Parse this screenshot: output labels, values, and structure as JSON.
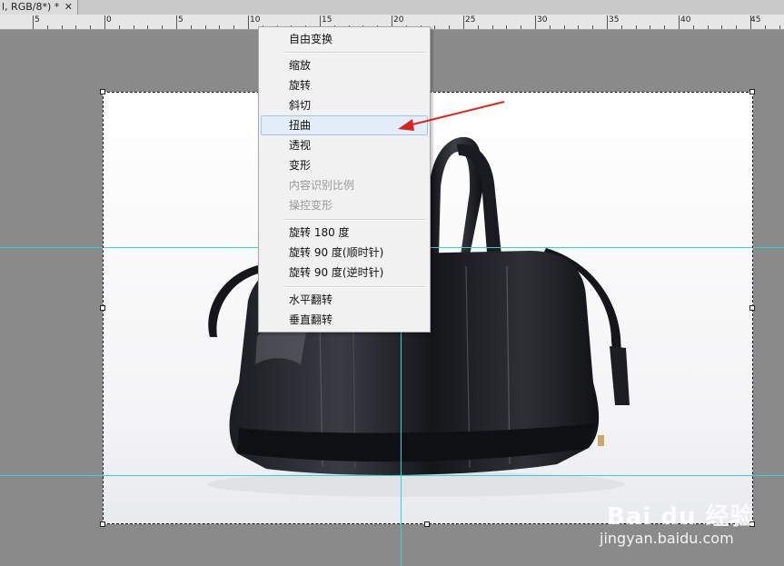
{
  "document_tab": {
    "title": "l, RGB/8*) *",
    "close_glyph": "✕"
  },
  "ruler": {
    "labels": [
      "5",
      "0",
      "5",
      "10",
      "15",
      "20",
      "25",
      "30",
      "35",
      "40",
      "45"
    ]
  },
  "menu": {
    "items": [
      {
        "label": "自由变换",
        "disabled": false
      },
      {
        "label": "缩放",
        "disabled": false
      },
      {
        "label": "旋转",
        "disabled": false
      },
      {
        "label": "斜切",
        "disabled": false
      },
      {
        "label": "扭曲",
        "disabled": false,
        "highlighted": true
      },
      {
        "label": "透视",
        "disabled": false
      },
      {
        "label": "变形",
        "disabled": false
      },
      {
        "label": "内容识别比例",
        "disabled": true
      },
      {
        "label": "操控变形",
        "disabled": true
      },
      {
        "label": "旋转 180 度",
        "disabled": false
      },
      {
        "label": "旋转 90 度(顺时针)",
        "disabled": false
      },
      {
        "label": "旋转 90 度(逆时针)",
        "disabled": false
      },
      {
        "label": "水平翻转",
        "disabled": false
      },
      {
        "label": "垂直翻转",
        "disabled": false
      }
    ]
  },
  "watermark": {
    "logo": "Bai du 经验",
    "url": "jingyan.baidu.com"
  },
  "colors": {
    "guide": "#34d0e0",
    "arrow": "#d9261c",
    "menu_highlight": "#e4eefb"
  }
}
